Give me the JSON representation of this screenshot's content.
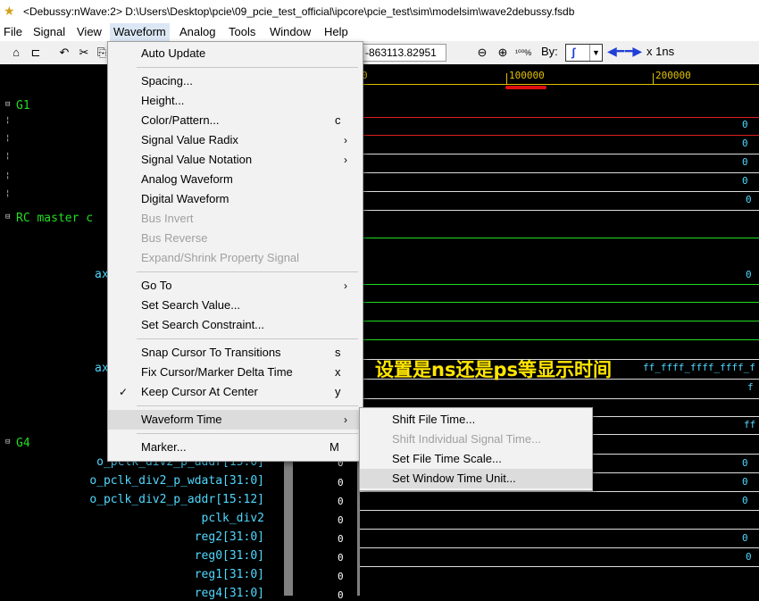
{
  "window": {
    "title": "<Debussy:nWave:2> D:\\Users\\Desktop\\pcie\\09_pcie_test_official\\ipcore\\pcie_test\\sim\\modelsim\\wave2debussy.fsdb"
  },
  "menubar": {
    "items": [
      "File",
      "Signal",
      "View",
      "Waveform",
      "Analog",
      "Tools",
      "Window",
      "Help"
    ],
    "active": "Waveform"
  },
  "toolbar": {
    "time_field": "-863113.82951",
    "by_label": "By:",
    "unit_label": "x 1ns"
  },
  "ruler": {
    "labels": [
      "0",
      "100000",
      "200000"
    ]
  },
  "signals_left": {
    "g1": "G1",
    "rc_master": "RC master c",
    "ax1": "ax",
    "ax2": "ax",
    "g4": "G4",
    "rows": [
      {
        "name": "o_pclk_div2_p_addr[15:0]",
        "value": "0"
      },
      {
        "name": "o_pclk_div2_p_wdata[31:0]",
        "value": "0"
      },
      {
        "name": "o_pclk_div2_p_addr[15:12]",
        "value": "0"
      },
      {
        "name": "pclk_div2",
        "value": "0"
      },
      {
        "name": "reg2[31:0]",
        "value": "0"
      },
      {
        "name": "reg0[31:0]",
        "value": "0"
      },
      {
        "name": "reg1[31:0]",
        "value": "0"
      },
      {
        "name": "reg4[31:0]",
        "value": "0"
      }
    ]
  },
  "wave_values": {
    "v1": "0",
    "v2": "0",
    "v3": "0",
    "v4": "0",
    "v5": "0",
    "v6": "0",
    "bus": "ff_ffff_ffff_ffff_f",
    "f": "f",
    "ff": "ff",
    "g4_1": "0",
    "g4_2": "0",
    "g4_3": "0",
    "g4_5": "0",
    "g4_6": "0"
  },
  "waveform_menu": {
    "auto_update": "Auto Update",
    "spacing": "Spacing...",
    "height": "Height...",
    "color_pattern": "Color/Pattern...",
    "color_pattern_shortcut": "c",
    "signal_value_radix": "Signal Value Radix",
    "signal_value_notation": "Signal Value Notation",
    "analog_waveform": "Analog Waveform",
    "digital_waveform": "Digital Waveform",
    "bus_invert": "Bus Invert",
    "bus_reverse": "Bus Reverse",
    "expand_shrink": "Expand/Shrink Property Signal",
    "go_to": "Go To",
    "set_search_value": "Set Search Value...",
    "set_search_constraint": "Set Search Constraint...",
    "snap_cursor": "Snap Cursor To Transitions",
    "snap_cursor_shortcut": "s",
    "fix_cursor": "Fix Cursor/Marker Delta Time",
    "fix_cursor_shortcut": "x",
    "keep_cursor": "Keep Cursor At Center",
    "keep_cursor_shortcut": "y",
    "waveform_time": "Waveform Time",
    "marker": "Marker...",
    "marker_shortcut": "M"
  },
  "waveform_time_submenu": {
    "shift_file_time": "Shift File Time...",
    "shift_individual": "Shift Individual Signal Time...",
    "set_file_time_scale": "Set File Time Scale...",
    "set_window_time_unit": "Set Window Time Unit..."
  },
  "annotation": {
    "text": "设置是ns还是ps等显示时间",
    "color": "#ffe600"
  },
  "colors": {
    "group_green": "#22dd22",
    "signal_cyan": "#4fd9ff",
    "ruler_yellow": "#e0c000",
    "red_mark": "#e01010"
  }
}
